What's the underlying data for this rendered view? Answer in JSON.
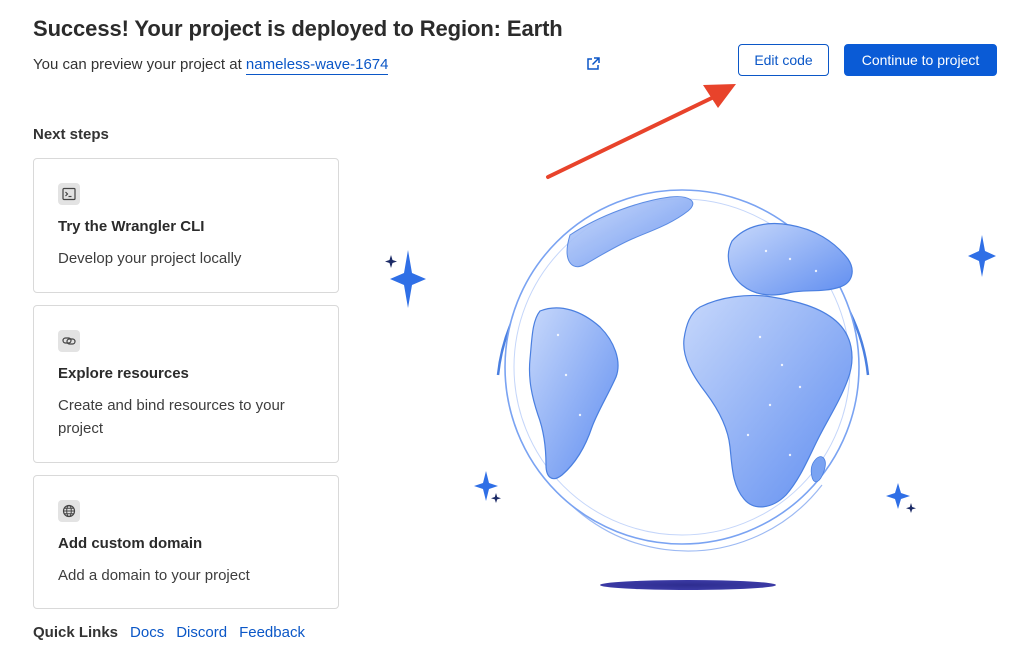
{
  "header": {
    "title": "Success! Your project is deployed to Region: Earth",
    "preview_prefix": "You can preview your project at",
    "preview_link": "nameless-wave-1674",
    "external_link_icon": "external-link-icon"
  },
  "actions": {
    "edit_code": "Edit code",
    "continue": "Continue to project"
  },
  "next_steps": {
    "heading": "Next steps",
    "cards": [
      {
        "icon": "terminal-icon",
        "title": "Try the Wrangler CLI",
        "description": "Develop your project locally"
      },
      {
        "icon": "link-icon",
        "title": "Explore resources",
        "description": "Create and bind resources to your project"
      },
      {
        "icon": "globe-icon",
        "title": "Add custom domain",
        "description": "Add a domain to your project"
      }
    ]
  },
  "quick_links": {
    "label": "Quick Links",
    "links": [
      "Docs",
      "Discord",
      "Feedback"
    ]
  },
  "colors": {
    "primary": "#0a5bd6",
    "link": "#0b57c7",
    "annotation_arrow": "#e8432b",
    "globe_land": "#7aa3f2",
    "globe_outline": "#4a7fe0",
    "sparkle": "#2f6fe6"
  }
}
